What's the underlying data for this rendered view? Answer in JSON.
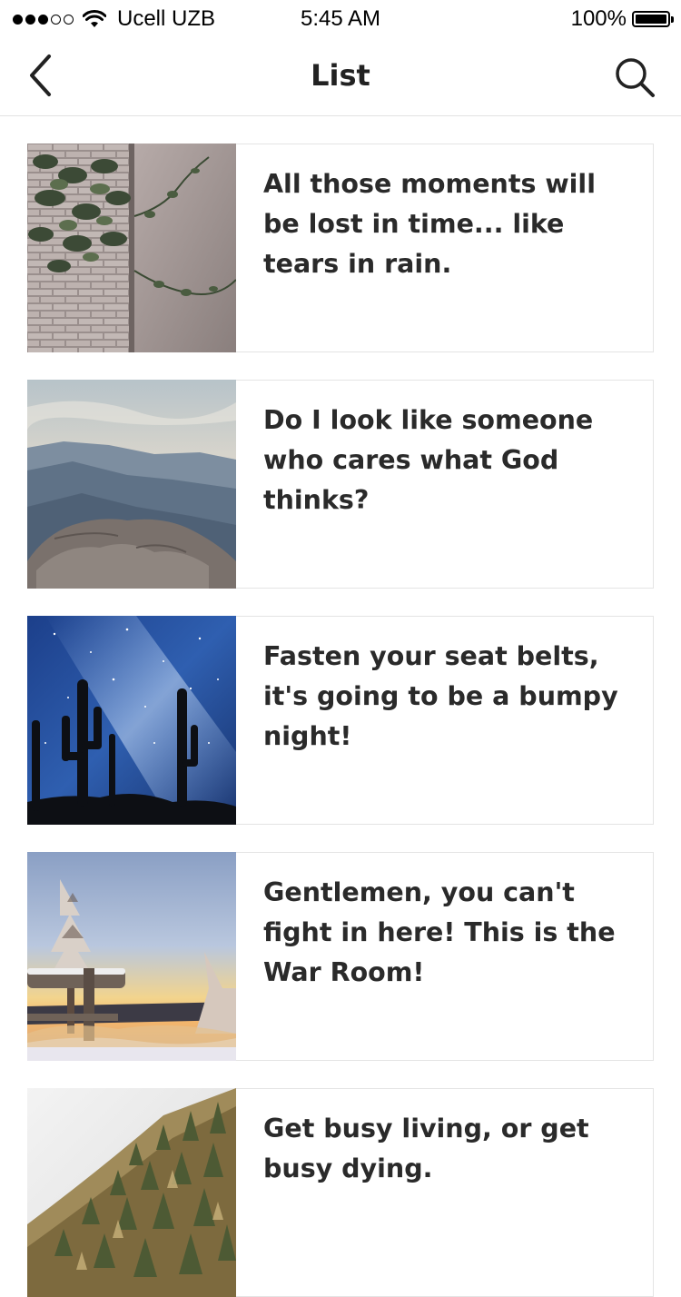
{
  "status_bar": {
    "carrier": "Ucell UZB",
    "time": "5:45 AM",
    "battery": "100%",
    "signal_bars_filled": 3,
    "signal_bars_total": 5
  },
  "nav": {
    "title": "List",
    "back_icon": "chevron-left-icon",
    "search_icon": "search-icon"
  },
  "items": [
    {
      "text": "All those moments will be lost in time... like tears in rain.",
      "image": "ivy-brick-wall"
    },
    {
      "text": "Do I look like someone who cares what God thinks?",
      "image": "mountain-rocks"
    },
    {
      "text": "Fasten your seat belts, it's going to be a bumpy night!",
      "image": "cactus-night-sky"
    },
    {
      "text": "Gentlemen, you can't fight in here! This is the War Room!",
      "image": "snowy-tree-sunset"
    },
    {
      "text": "Get busy living, or get busy dying.",
      "image": "pine-forest-hill"
    }
  ]
}
